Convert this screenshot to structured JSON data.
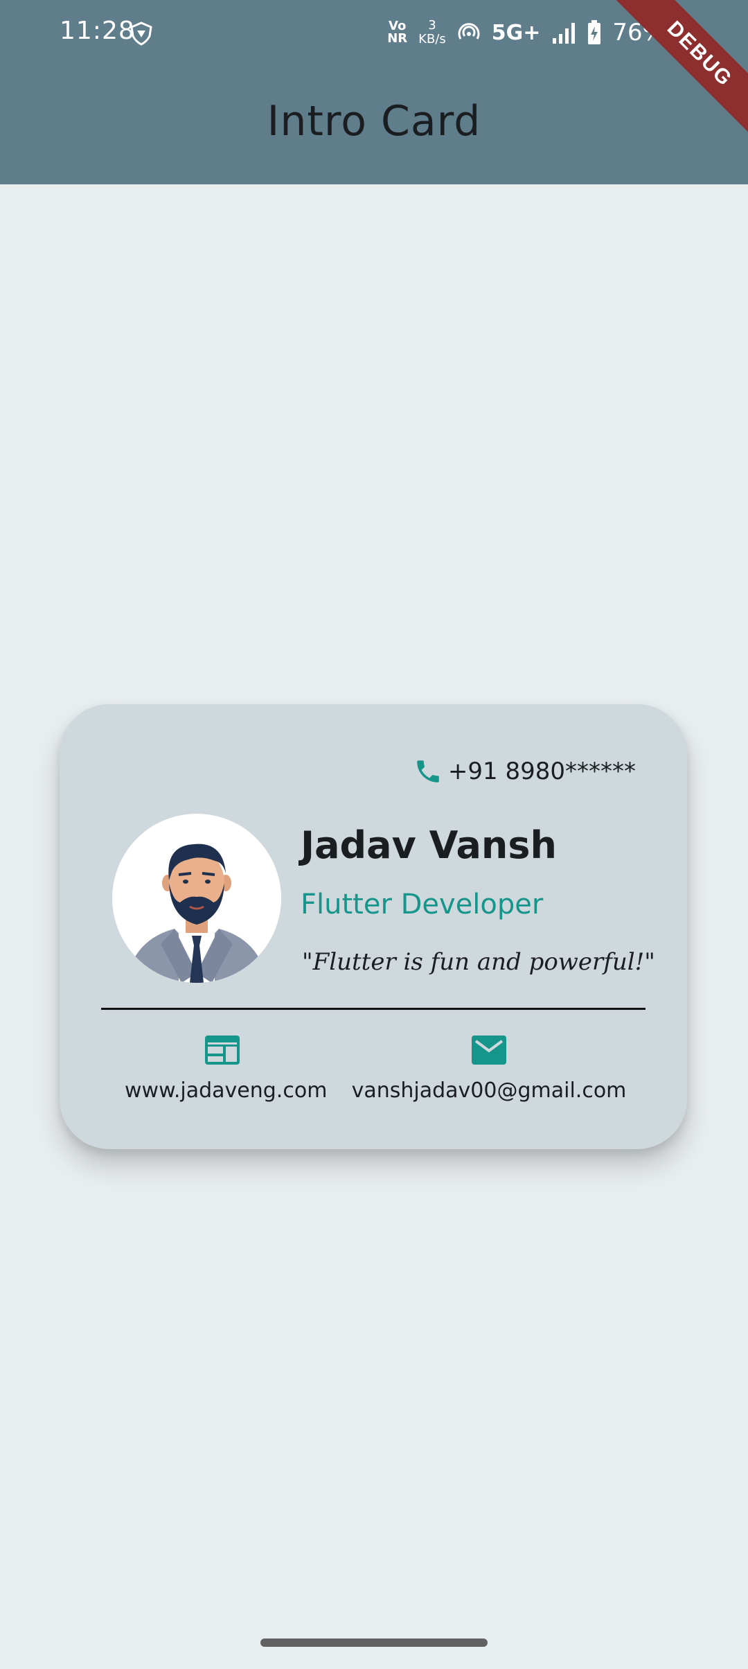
{
  "status_bar": {
    "time": "11:28",
    "vonr_top": "Vo",
    "vonr_bottom": "NR",
    "speed_value": "3",
    "speed_unit": "KB/s",
    "network": "5G+",
    "battery": "76%"
  },
  "app_bar": {
    "title": "Intro Card",
    "background": "#607d8b"
  },
  "debug_banner": "DEBUG",
  "card": {
    "phone": "+91 8980******",
    "name": "Jadav Vansh",
    "role": "Flutter Developer",
    "quote": "\"Flutter is fun and powerful!\"",
    "website": "www.jadaveng.com",
    "email": "vanshjadav00@gmail.com",
    "accent": "#16958a",
    "background": "#cfd8dc"
  },
  "icons": {
    "phone": "phone-icon",
    "website": "web-icon",
    "email": "mail-icon",
    "avatar": "avatar-illustration"
  }
}
